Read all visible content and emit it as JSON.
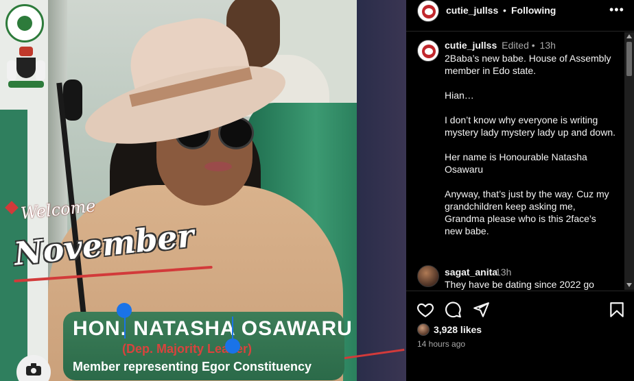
{
  "post": {
    "header": {
      "username": "cutie_jullss",
      "separator": "•",
      "follow_status": "Following",
      "more_icon": "more-horizontal-icon"
    },
    "caption": {
      "username": "cutie_jullss",
      "edited": "Edited •",
      "time": "13h",
      "text": "2Baba’s new babe. House of Assembly member in Edo state.\n\nHian…\n\nI don’t know why everyone is writing mystery lady mystery lady up and down.\n\nHer name is Honourable Natasha Osawaru\n\nAnyway, that’s just by the way. Cuz my grandchildren keep asking me, Grandma please who is this 2face’s new babe."
    },
    "comments": [
      {
        "username": "sagat_anita",
        "time": "13h",
        "text": "They have be dating since 2022 go"
      }
    ],
    "actions": {
      "like_icon": "heart-icon",
      "comment_icon": "comment-icon",
      "share_icon": "share-icon",
      "save_icon": "bookmark-icon"
    },
    "likes": "3,928 likes",
    "age": "14 hours ago"
  },
  "photo": {
    "welcome_text": "Welcome",
    "month_text": "November",
    "banner": {
      "name_line": "HON. NATASHA OSAWARU",
      "role_line": "(Dep. Majority Leader)",
      "member_line": "Member representing Egor Constituency"
    }
  },
  "colors": {
    "background": "#000000",
    "text_primary": "#f5f5f5",
    "text_secondary": "#a8a8a8",
    "banner_green": "#2b6a49",
    "role_red": "#d9433d",
    "selection_blue": "#1a73e8"
  }
}
